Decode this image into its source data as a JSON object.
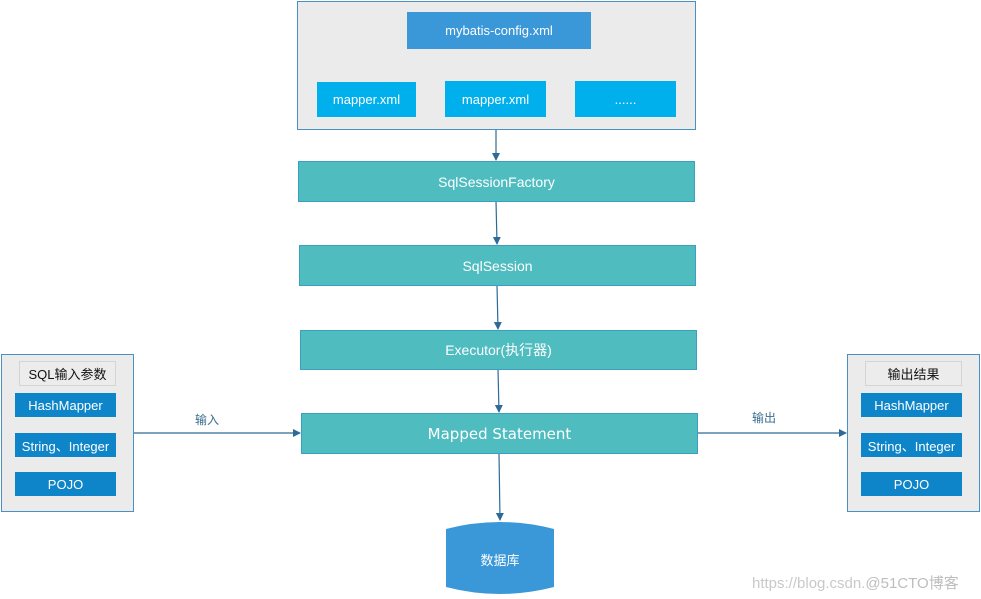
{
  "config_group": {
    "config_file": "mybatis-config.xml",
    "mappers": [
      "mapper.xml",
      "mapper.xml",
      "......"
    ]
  },
  "flow": {
    "factory": "SqlSessionFactory",
    "session": "SqlSession",
    "executor": "Executor(执行器)",
    "mapped_statement": "Mapped Statement",
    "database": "数据库"
  },
  "input": {
    "title": "SQL输入参数",
    "types": [
      "HashMapper",
      "String、Integer",
      "POJO"
    ],
    "arrow_label": "输入"
  },
  "output": {
    "title": "输出结果",
    "types": [
      "HashMapper",
      "String、Integer",
      "POJO"
    ],
    "arrow_label": "输出"
  },
  "watermark": {
    "url": "https://blog.csdn.",
    "site": "@51CTO博客"
  }
}
